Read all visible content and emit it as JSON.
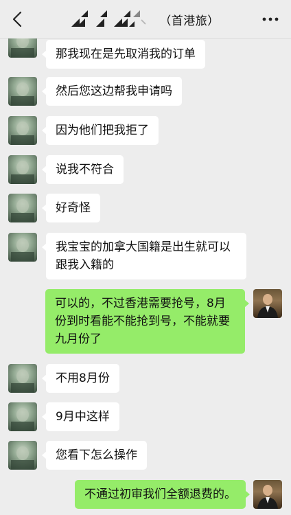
{
  "header": {
    "title": "（首港旅）",
    "back_icon": "chevron-left-icon",
    "more_icon": "more-dots-icon",
    "logo_icon": "brand-logo-icon"
  },
  "messages": [
    {
      "side": "in",
      "text": "那我现在是先取消我的订单"
    },
    {
      "side": "in",
      "text": "然后您这边帮我申请吗"
    },
    {
      "side": "in",
      "text": "因为他们把我拒了"
    },
    {
      "side": "in",
      "text": "说我不符合"
    },
    {
      "side": "in",
      "text": "好奇怪"
    },
    {
      "side": "in",
      "text": "我宝宝的加拿大国籍是出生就可以跟我入籍的"
    },
    {
      "side": "out",
      "text": "可以的，不过香港需要抢号，8月份到时看能不能抢到号，不能就要九月份了"
    },
    {
      "side": "in",
      "text": "不用8月份"
    },
    {
      "side": "in",
      "text": "9月中这样"
    },
    {
      "side": "in",
      "text": "您看下怎么操作"
    },
    {
      "side": "out",
      "text": "不通过初审我们全额退费的。"
    }
  ],
  "colors": {
    "background": "#ededed",
    "incoming_bubble": "#ffffff",
    "outgoing_bubble": "#95ec69"
  }
}
